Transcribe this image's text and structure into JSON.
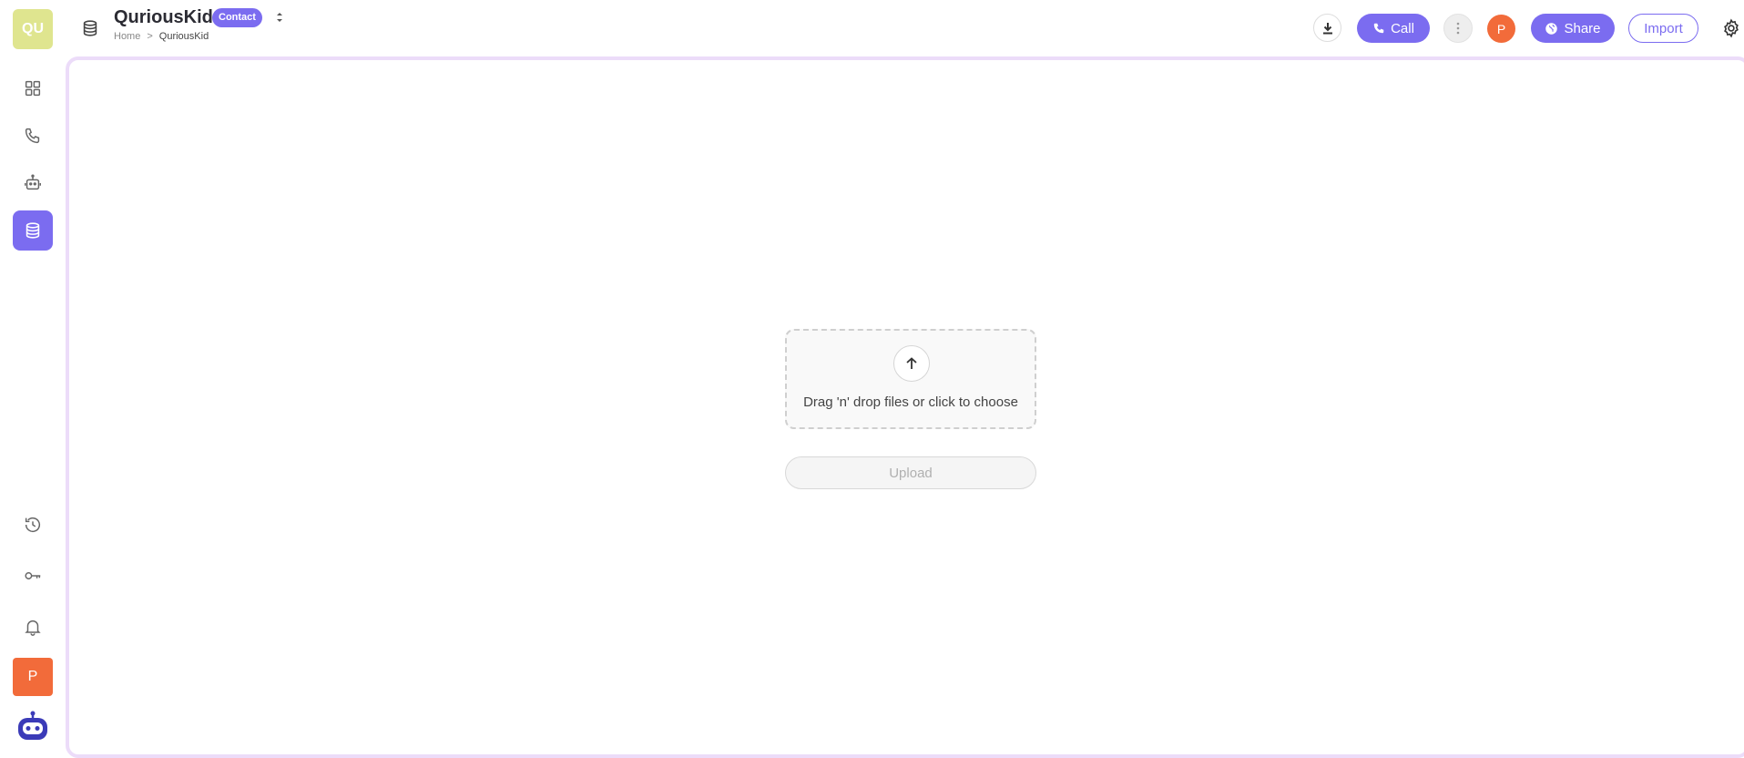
{
  "workspace": {
    "initials": "QU"
  },
  "sidebar": {
    "items": [
      {
        "icon": "dashboard-icon"
      },
      {
        "icon": "phone-icon"
      },
      {
        "icon": "robot-icon"
      },
      {
        "icon": "database-icon",
        "active": true
      }
    ],
    "bottom_items": [
      {
        "icon": "history-icon"
      },
      {
        "icon": "key-icon"
      },
      {
        "icon": "bell-icon"
      }
    ],
    "user_initial": "P"
  },
  "header": {
    "title": "QuriousKid",
    "tag": "Contact",
    "breadcrumb": {
      "home": "Home",
      "separator": ">",
      "current": "QuriousKid"
    },
    "call_label": "Call",
    "avatar_initial": "P",
    "share_label": "Share",
    "import_label": "Import"
  },
  "upload": {
    "dropzone_text": "Drag 'n' drop files or click to choose",
    "button_label": "Upload"
  },
  "colors": {
    "accent": "#7b6cf0",
    "avatar_orange": "#f26b3a",
    "workspace_yellow": "#dfe58f",
    "panel_border": "#ecdcf9"
  }
}
